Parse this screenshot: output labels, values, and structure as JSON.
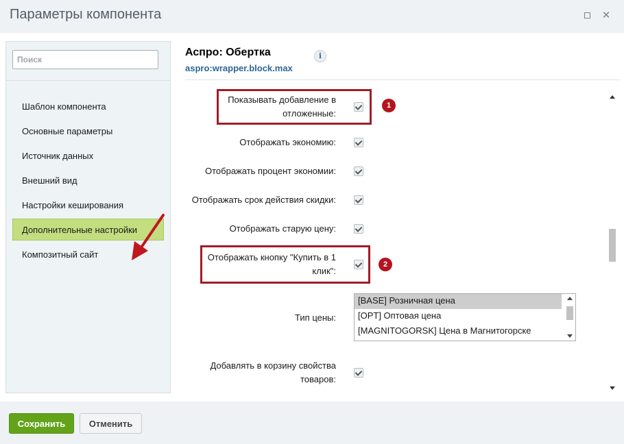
{
  "window": {
    "title": "Параметры компонента"
  },
  "sidebar": {
    "search_placeholder": "Поиск",
    "items": [
      {
        "label": "Шаблон компонента",
        "active": false
      },
      {
        "label": "Основные параметры",
        "active": false
      },
      {
        "label": "Источник данных",
        "active": false
      },
      {
        "label": "Внешний вид",
        "active": false
      },
      {
        "label": "Настройки кеширования",
        "active": false
      },
      {
        "label": "Дополнительные настройки",
        "active": true
      },
      {
        "label": "Композитный сайт",
        "active": false
      }
    ]
  },
  "component": {
    "name": "Аспро: Обертка",
    "code": "aspro:wrapper.block.max",
    "info_icon_label": "i"
  },
  "settings": {
    "show_delay_add": {
      "label_line1": "Показывать добавление в",
      "label_line2": "отложенные:",
      "checked": true
    },
    "show_economy": {
      "label": "Отображать экономию:",
      "checked": true
    },
    "show_economy_percent": {
      "label": "Отображать процент экономии:",
      "checked": true
    },
    "show_discount_time": {
      "label": "Отображать срок действия скидки:",
      "checked": true
    },
    "show_old_price": {
      "label": "Отображать старую цену:",
      "checked": true
    },
    "show_one_click": {
      "label_line1": "Отображать кнопку \"Купить в 1",
      "label_line2": "клик\":",
      "checked": true
    },
    "price_type": {
      "label": "Тип цены:",
      "options": [
        "[BASE] Розничная цена",
        "[OPT] Оптовая цена",
        "[MAGNITOGORSK] Цена в Магнитогорске"
      ],
      "selected_index": 0
    },
    "add_props_to_basket": {
      "label_line1": "Добавлять в корзину свойства",
      "label_line2": "товаров:",
      "checked": true
    }
  },
  "annotations": {
    "badge1": "1",
    "badge2": "2",
    "highlight_color": "#a11c27"
  },
  "footer": {
    "save_label": "Сохранить",
    "cancel_label": "Отменить"
  },
  "colors": {
    "accent_green": "#62a31a",
    "active_nav": "#c3de7f",
    "link_blue": "#2e6696"
  }
}
